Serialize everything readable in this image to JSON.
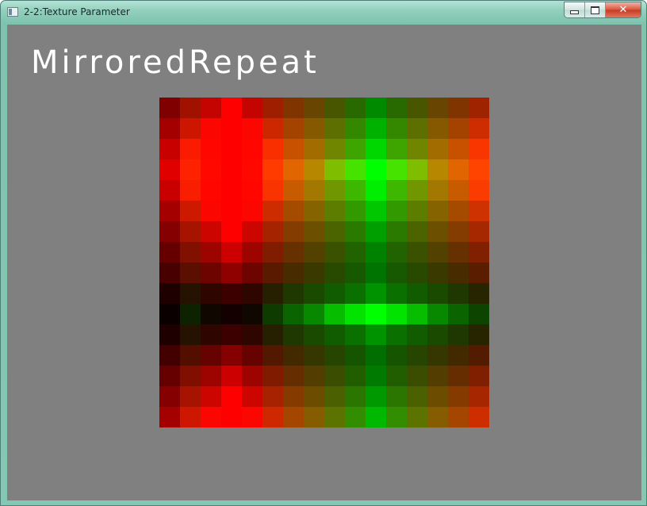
{
  "window": {
    "title": "2-2:Texture Parameter",
    "controls": {
      "minimize": "minimize",
      "maximize": "maximize",
      "close": "✕"
    }
  },
  "client": {
    "background": "#808080",
    "mode_label": "MirroredRepeat"
  },
  "texture": {
    "wrap_mode": "MirroredRepeat",
    "columns": [
      {
        "r": 128,
        "g": 0
      },
      {
        "r": 160,
        "g": 32
      },
      {
        "r": 196,
        "g": 8
      },
      {
        "r": 255,
        "g": 0
      },
      {
        "r": 196,
        "g": 8
      },
      {
        "r": 160,
        "g": 56
      },
      {
        "r": 128,
        "g": 96
      },
      {
        "r": 104,
        "g": 128
      },
      {
        "r": 72,
        "g": 160
      },
      {
        "r": 40,
        "g": 196
      },
      {
        "r": 0,
        "g": 255
      },
      {
        "r": 40,
        "g": 196
      },
      {
        "r": 72,
        "g": 160
      },
      {
        "r": 104,
        "g": 128
      },
      {
        "r": 128,
        "g": 96
      },
      {
        "r": 160,
        "g": 64
      }
    ],
    "rows": [
      {
        "r": 0.5,
        "g": 0.45
      },
      {
        "r": 0.64,
        "g": 0.58
      },
      {
        "r": 0.78,
        "g": 0.7
      },
      {
        "r": 0.88,
        "g": 0.88
      },
      {
        "r": 0.78,
        "g": 0.78
      },
      {
        "r": 0.64,
        "g": 0.65
      },
      {
        "r": 0.52,
        "g": 0.52
      },
      {
        "r": 0.4,
        "g": 0.42
      },
      {
        "r": 0.28,
        "g": 0.38
      },
      {
        "r": 0.12,
        "g": 0.48
      },
      {
        "r": 0.04,
        "g": 0.88
      },
      {
        "r": 0.12,
        "g": 0.48
      },
      {
        "r": 0.26,
        "g": 0.36
      },
      {
        "r": 0.4,
        "g": 0.4
      },
      {
        "r": 0.52,
        "g": 0.5
      },
      {
        "r": 0.64,
        "g": 0.6
      }
    ]
  }
}
